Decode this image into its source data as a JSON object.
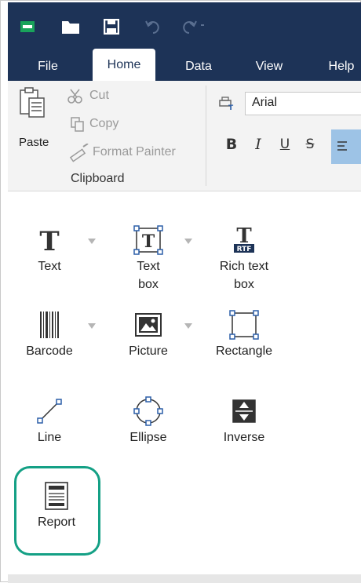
{
  "ribbon_tabs": [
    {
      "label": "File",
      "active": false
    },
    {
      "label": "Home",
      "active": true
    },
    {
      "label": "Data",
      "active": false
    },
    {
      "label": "View",
      "active": false
    },
    {
      "label": "Help",
      "active": false
    }
  ],
  "quick_access": {
    "icons": [
      "app-icon",
      "open-folder-icon",
      "save-icon",
      "undo-icon",
      "redo-icon"
    ]
  },
  "clipboard": {
    "paste_label": "Paste",
    "cut_label": "Cut",
    "copy_label": "Copy",
    "format_painter_label": "Format Painter",
    "group_label": "Clipboard"
  },
  "font": {
    "family_value": "Arial",
    "bold": "B",
    "italic": "I",
    "underline": "U",
    "strike": "S"
  },
  "objects": {
    "text": "Text",
    "text_box_line1": "Text",
    "text_box_line2": "box",
    "rich_text_line1": "Rich text",
    "rich_text_line2": "box",
    "rich_text_badge": "RTF",
    "barcode": "Barcode",
    "picture": "Picture",
    "rectangle": "Rectangle",
    "line": "Line",
    "ellipse": "Ellipse",
    "inverse": "Inverse",
    "report": "Report"
  },
  "colors": {
    "title_bar": "#1d3357",
    "highlight_outline": "#14a085",
    "handle_blue": "#2c5fa8"
  }
}
